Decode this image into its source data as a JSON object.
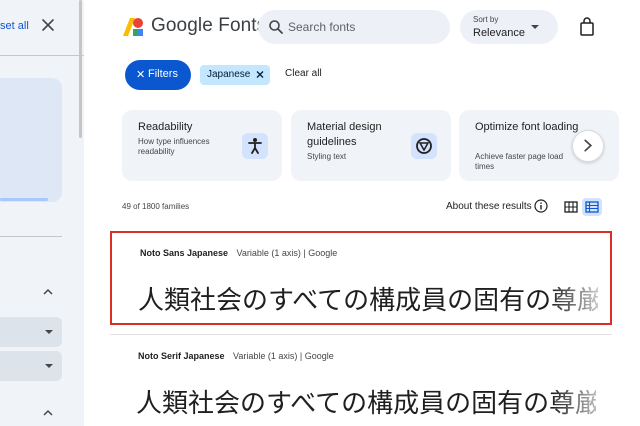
{
  "sidebar": {
    "reset_all": "Reset all"
  },
  "header": {
    "logo": "Google Fonts",
    "search_placeholder": "Search fonts",
    "sort_label": "Sort by",
    "sort_value": "Relevance"
  },
  "filters": {
    "filters_button": "Filters",
    "chips": [
      "Japanese"
    ],
    "clear_all": "Clear all"
  },
  "cards": [
    {
      "title": "Readability",
      "subtitle": "How type influences readability",
      "icon": "accessibility-icon"
    },
    {
      "title": "Material design guidelines",
      "subtitle": "Styling text",
      "icon": "material-icon"
    },
    {
      "title": "Optimize font loading",
      "subtitle": "Achieve faster page load times",
      "icon": ""
    }
  ],
  "results": {
    "count": "49 of 1800 families",
    "about": "About these results"
  },
  "fonts": [
    {
      "name": "Noto Sans Japanese",
      "meta": "Variable (1 axis)  |  Google",
      "sample": "人類社会のすべての構成員の固有の尊厳"
    },
    {
      "name": "Noto Serif Japanese",
      "meta": "Variable (1 axis)  |  Google",
      "sample": "人類社会のすべての構成員の固有の尊厳"
    }
  ],
  "colors": {
    "accent": "#0b57d0",
    "selected_outline": "#d93025",
    "chip": "#c2e7ff"
  }
}
